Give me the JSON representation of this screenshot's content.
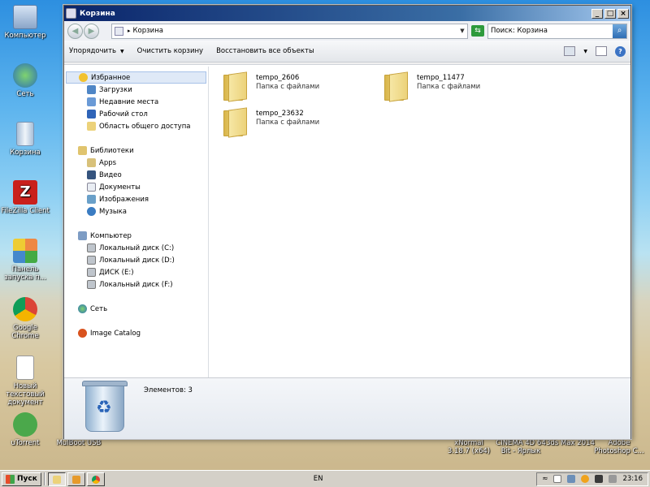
{
  "window": {
    "title": "Корзина",
    "address": "Корзина",
    "search_placeholder": "Поиск: Корзина"
  },
  "toolbar": {
    "organize": "Упорядочить",
    "empty": "Очистить корзину",
    "restore_all": "Восстановить все объекты"
  },
  "nav": {
    "favorites": "Избранное",
    "favorites_items": [
      "Загрузки",
      "Недавние места",
      "Рабочий стол",
      "Область общего доступа"
    ],
    "libraries": "Библиотеки",
    "library_items": [
      "Apps",
      "Видео",
      "Документы",
      "Изображения",
      "Музыка"
    ],
    "computer": "Компьютер",
    "computer_items": [
      "Локальный диск (C:)",
      "Локальный диск (D:)",
      "ДИСК (E:)",
      "Локальный диск (F:)"
    ],
    "network": "Сеть",
    "image_catalog": "Image Catalog"
  },
  "files": [
    {
      "name": "tempo_2606",
      "type": "Папка с файлами"
    },
    {
      "name": "tempo_11477",
      "type": "Папка с файлами"
    },
    {
      "name": "tempo_23632",
      "type": "Папка с файлами"
    }
  ],
  "details": {
    "count": "Элементов: 3"
  },
  "desktop": {
    "computer": "Компьютер",
    "network": "Сеть",
    "recycle": "Корзина",
    "filezilla": "FileZilla Client",
    "control_panel": "Панель запуска п...",
    "chrome": "Google Chrome",
    "doc": "Новый текстовый документ",
    "utorrent": "uTorrent",
    "mulboot": "MulBoot USB",
    "xnormal": "xNormal 3.18.7 (x64)",
    "cinema4d": "CINEMA 4D 64 Bit - Ярлык",
    "max": "3ds Max 2014",
    "photoshop": "Adobe Photoshop C..."
  },
  "taskbar": {
    "start": "Пуск",
    "lang": "EN",
    "clock": "23:16"
  },
  "colors": {
    "title_start": "#0a246a",
    "title_end": "#a6caf0",
    "selection": "#dfe9f7"
  }
}
